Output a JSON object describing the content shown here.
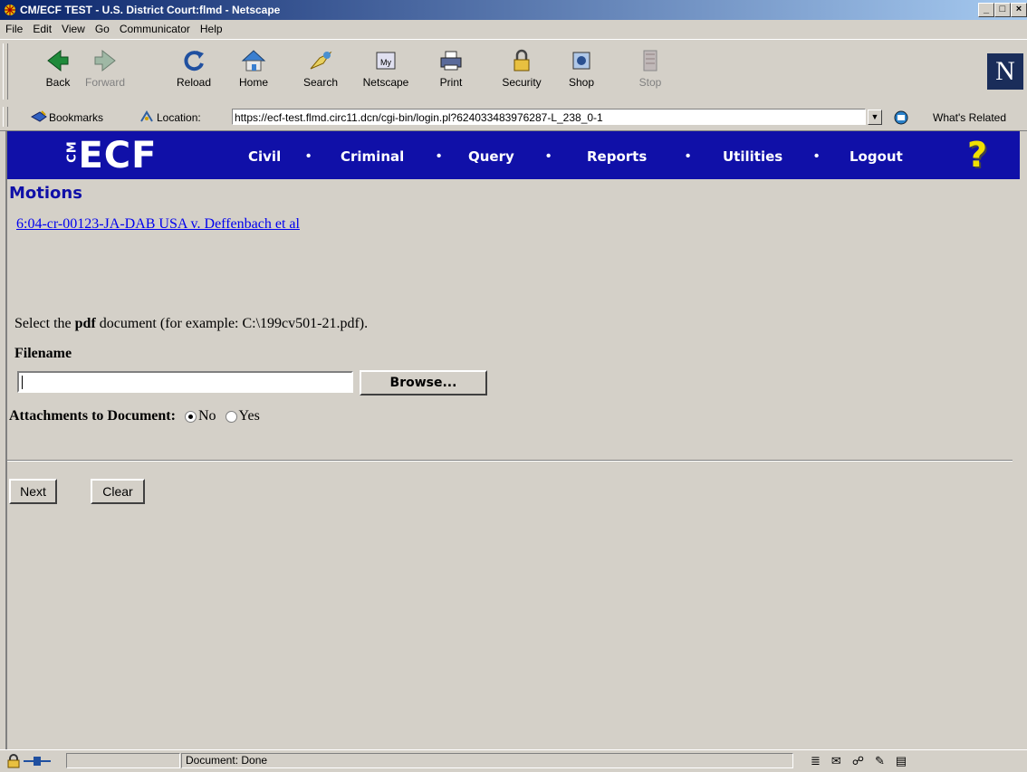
{
  "window": {
    "title": "CM/ECF TEST - U.S. District Court:flmd - Netscape"
  },
  "menu": [
    "File",
    "Edit",
    "View",
    "Go",
    "Communicator",
    "Help"
  ],
  "toolbar": {
    "back": "Back",
    "forward": "Forward",
    "reload": "Reload",
    "home": "Home",
    "search": "Search",
    "netscape": "Netscape",
    "print": "Print",
    "security": "Security",
    "shop": "Shop",
    "stop": "Stop",
    "logo": "N"
  },
  "location": {
    "bookmarks": "Bookmarks",
    "label": "Location:",
    "url": "https://ecf-test.flmd.circ11.dcn/cgi-bin/login.pl?624033483976287-L_238_0-1",
    "related": "What's Related"
  },
  "ecf": {
    "logo": "ECF",
    "logo_prefix": "CM",
    "nav": [
      "Civil",
      "Criminal",
      "Query",
      "Reports",
      "Utilities",
      "Logout"
    ],
    "help": "?"
  },
  "page": {
    "heading": "Motions",
    "case_link": "6:04-cr-00123-JA-DAB USA v. Deffenbach et al",
    "instruction_pre": "Select the ",
    "instruction_bold": "pdf",
    "instruction_post": " document (for example: C:\\199cv501-21.pdf).",
    "filename_label": "Filename",
    "filename_value": "",
    "browse_label": "Browse...",
    "attachments_label": "Attachments to Document:",
    "attach_no": "No",
    "attach_yes": "Yes",
    "attach_selected": "No",
    "next_label": "Next",
    "clear_label": "Clear"
  },
  "status": {
    "text": "Document: Done"
  }
}
